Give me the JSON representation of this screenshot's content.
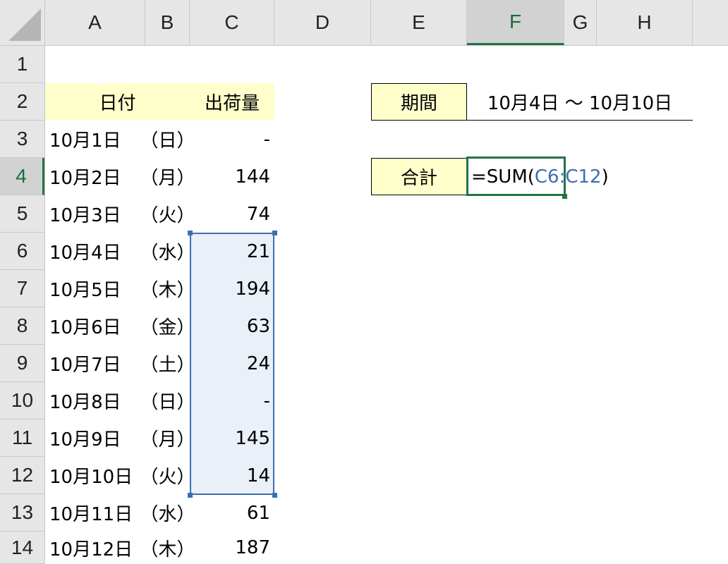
{
  "columns": [
    "A",
    "B",
    "C",
    "D",
    "E",
    "F",
    "G",
    "H"
  ],
  "rows": [
    "1",
    "2",
    "3",
    "4",
    "5",
    "6",
    "7",
    "8",
    "9",
    "10",
    "11",
    "12",
    "13",
    "14"
  ],
  "active": {
    "column": "F",
    "row": "4"
  },
  "table": {
    "header_date": "日付",
    "header_qty": "出荷量",
    "records": [
      {
        "date": "10月1日",
        "day": "（日）",
        "qty": "-"
      },
      {
        "date": "10月2日",
        "day": "（月）",
        "qty": "144"
      },
      {
        "date": "10月3日",
        "day": "（火）",
        "qty": "74"
      },
      {
        "date": "10月4日",
        "day": "（水）",
        "qty": "21"
      },
      {
        "date": "10月5日",
        "day": "（木）",
        "qty": "194"
      },
      {
        "date": "10月6日",
        "day": "（金）",
        "qty": "63"
      },
      {
        "date": "10月7日",
        "day": "（土）",
        "qty": "24"
      },
      {
        "date": "10月8日",
        "day": "（日）",
        "qty": "-"
      },
      {
        "date": "10月9日",
        "day": "（月）",
        "qty": "145"
      },
      {
        "date": "10月10日",
        "day": "（火）",
        "qty": "14"
      },
      {
        "date": "10月11日",
        "day": "（水）",
        "qty": "61"
      },
      {
        "date": "10月12日",
        "day": "（木）",
        "qty": "187"
      }
    ]
  },
  "period": {
    "label": "期間",
    "value": "10月4日 ～ 10月10日"
  },
  "total": {
    "label": "合計",
    "formula_prefix": "=SUM(",
    "formula_range": "C6:C12",
    "formula_suffix": ")"
  },
  "colors": {
    "accent_green": "#217346",
    "range_blue": "#3a6fb0",
    "header_fill": "#ffffcc"
  }
}
